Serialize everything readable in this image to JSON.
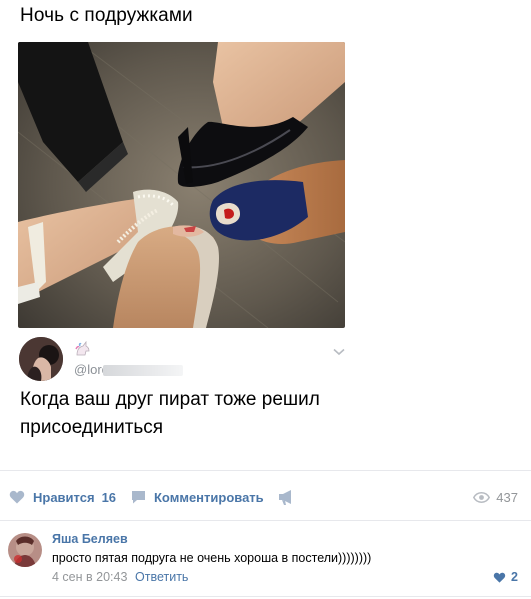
{
  "post": {
    "title": "Ночь с подружками"
  },
  "tweet": {
    "handle": "@lorc",
    "text": "Когда ваш друг пират тоже решил присоединиться"
  },
  "actions": {
    "like_label": "Нравится",
    "like_count": "16",
    "comment_label": "Комментировать",
    "views_count": "437"
  },
  "comment": {
    "author": "Яша Беляев",
    "text": "просто пятая подруга не очень хороша в постели))))))))",
    "date": "4 сен в 20:43",
    "reply_label": "Ответить",
    "like_count": "2"
  },
  "colors": {
    "link": "#4a76a8",
    "muted": "#939699",
    "divider": "#e7e8ec"
  },
  "icons": [
    "heart-icon",
    "comment-icon",
    "share-megaphone-icon",
    "eye-icon",
    "chevron-down-icon",
    "unicorn-icon"
  ]
}
